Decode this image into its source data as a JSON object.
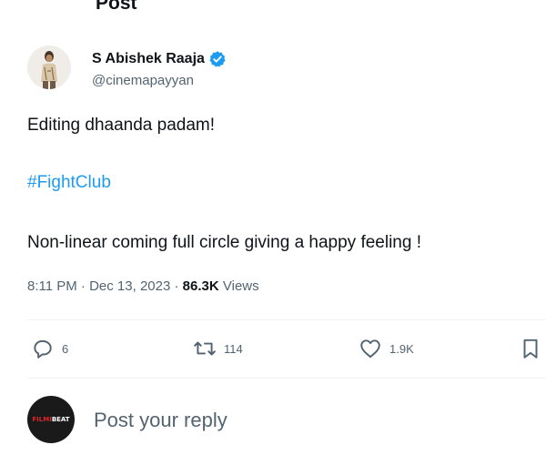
{
  "header": {
    "title": "Post",
    "back_icon": "arrow-left-icon"
  },
  "author": {
    "name": "S Abishek Raaja",
    "handle": "@cinemapayyan",
    "verified_icon": "verified-badge-icon",
    "verified_color": "#1d9bf0"
  },
  "tweet": {
    "line1": "Editing dhaanda padam!",
    "hashtag": "#FightClub",
    "line3": "Non-linear coming full circle giving a happy feeling !"
  },
  "meta": {
    "time": "8:11 PM",
    "separator1": " · ",
    "date": "Dec 13, 2023",
    "separator2": " · ",
    "views_count": "86.3K",
    "views_label": "Views"
  },
  "actions": {
    "reply": {
      "icon": "reply-icon",
      "count": "6"
    },
    "retweet": {
      "icon": "retweet-icon",
      "count": "114"
    },
    "like": {
      "icon": "heart-icon",
      "count": "1.9K"
    },
    "bookmark": {
      "icon": "bookmark-icon"
    }
  },
  "reply_box": {
    "placeholder": "Post your reply",
    "avatar_logo_part1": "FILMI",
    "avatar_logo_part2": "BEAT"
  },
  "colors": {
    "accent": "#1d9bf0",
    "text_primary": "#0f1419",
    "text_secondary": "#536471",
    "divider": "#eff3f4"
  }
}
